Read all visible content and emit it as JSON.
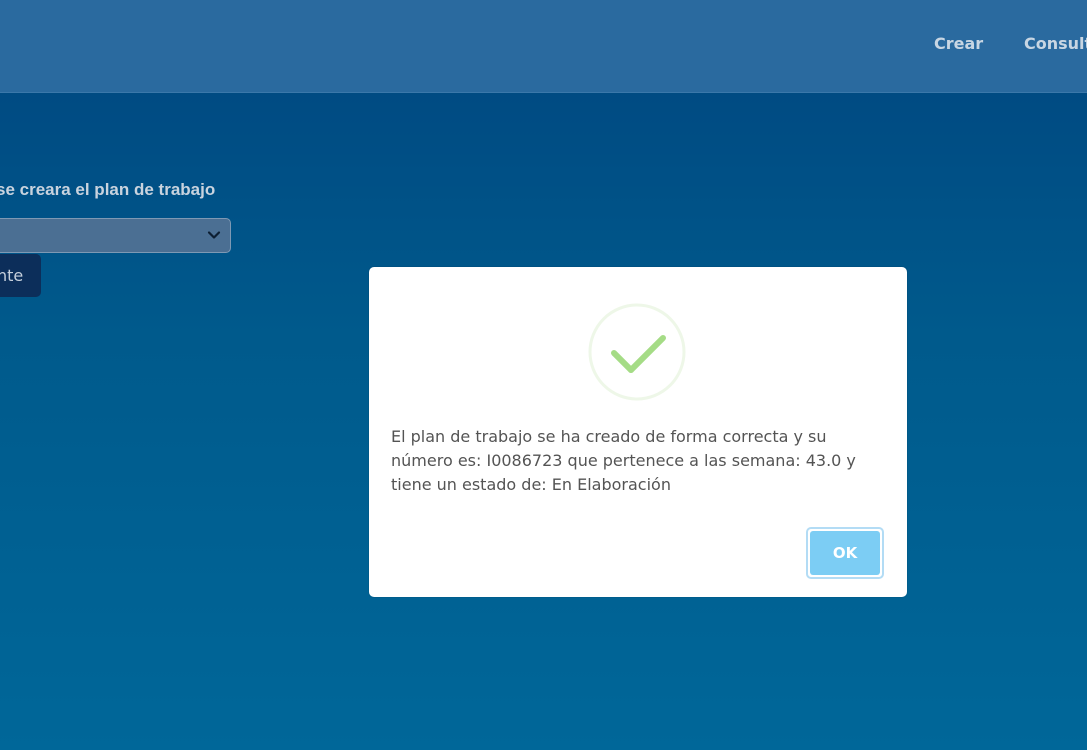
{
  "nav": {
    "create_label": "Crear",
    "consult_label": "Consult"
  },
  "form": {
    "label": "se creara el plan de trabajo",
    "select_value": "",
    "next_button_label": "nte"
  },
  "dialog": {
    "icon": "success-check-icon",
    "message": "El plan de trabajo se ha creado de forma correcta y su número es: I0086723 que pertenece a las semana: 43.0 y tiene un estado de: En Elaboración",
    "ok_label": "OK"
  },
  "colors": {
    "background_top": "#00457f",
    "background_bottom": "#006799",
    "topbar": "#2a6a9f",
    "success_green": "#a5dc86",
    "ok_button": "#7ccdf4"
  }
}
